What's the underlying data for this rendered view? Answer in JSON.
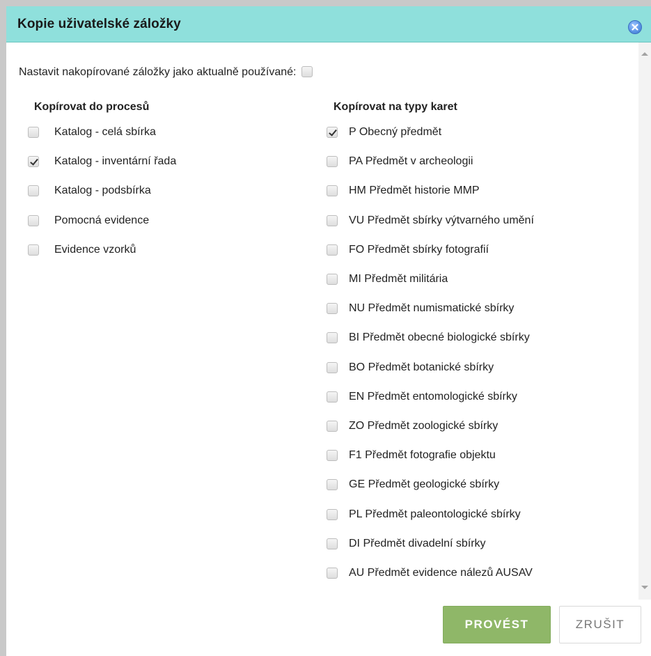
{
  "dialog": {
    "title": "Kopie uživatelské záložky",
    "close_icon": "close-circle-icon"
  },
  "top_option": {
    "label": "Nastavit nakopírované záložky jako aktualně používané:",
    "checked": false
  },
  "processes": {
    "heading": "Kopírovat do procesů",
    "items": [
      {
        "label": "Katalog - celá sbírka",
        "checked": false
      },
      {
        "label": "Katalog - inventární řada",
        "checked": true
      },
      {
        "label": "Katalog - podsbírka",
        "checked": false
      },
      {
        "label": "Pomocná evidence",
        "checked": false
      },
      {
        "label": "Evidence vzorků",
        "checked": false
      }
    ]
  },
  "card_types": {
    "heading": "Kopírovat na typy karet",
    "items": [
      {
        "label": "P Obecný předmět",
        "checked": true
      },
      {
        "label": "PA Předmět v archeologii",
        "checked": false
      },
      {
        "label": "HM Předmět historie MMP",
        "checked": false
      },
      {
        "label": "VU Předmět sbírky výtvarného umění",
        "checked": false
      },
      {
        "label": "FO Předmět sbírky fotografií",
        "checked": false
      },
      {
        "label": "MI Předmět militária",
        "checked": false
      },
      {
        "label": "NU Předmět numismatické sbírky",
        "checked": false
      },
      {
        "label": "BI Předmět obecné biologické sbírky",
        "checked": false
      },
      {
        "label": "BO Předmět botanické sbírky",
        "checked": false
      },
      {
        "label": "EN Předmět entomologické sbírky",
        "checked": false
      },
      {
        "label": "ZO Předmět zoologické sbírky",
        "checked": false
      },
      {
        "label": "F1 Předmět fotografie objektu",
        "checked": false
      },
      {
        "label": "GE Předmět geologické sbírky",
        "checked": false
      },
      {
        "label": "PL Předmět paleontologické sbírky",
        "checked": false
      },
      {
        "label": "DI Předmět divadelní sbírky",
        "checked": false
      },
      {
        "label": "AU Předmět evidence nálezů AUSAV",
        "checked": false
      }
    ]
  },
  "buttons": {
    "execute_label": "PROVÉST",
    "cancel_label": "ZRUŠIT"
  },
  "colors": {
    "titlebar": "#8fe0dc",
    "execute": "#8fb768"
  }
}
